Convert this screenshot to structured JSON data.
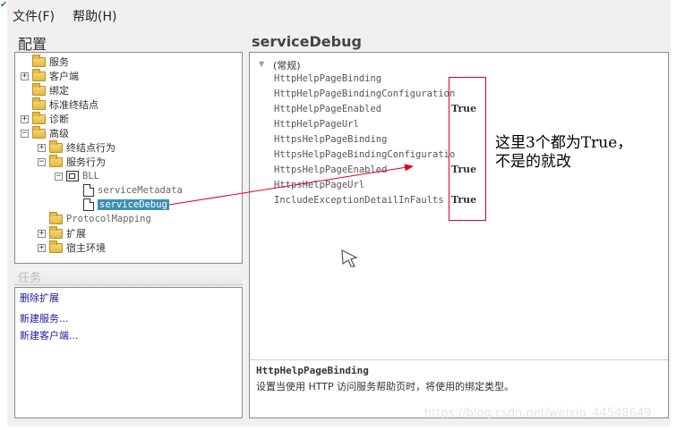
{
  "menubar": {
    "file": "文件(F)",
    "help": "帮助(H)"
  },
  "config_panel": {
    "title": "配置",
    "tree": [
      {
        "label": "服务",
        "icon": "folder-icon",
        "exp": ""
      },
      {
        "label": "客户端",
        "icon": "folder-icon",
        "exp": "+"
      },
      {
        "label": "绑定",
        "icon": "folder-icon",
        "exp": ""
      },
      {
        "label": "标准终结点",
        "icon": "folder-icon",
        "exp": ""
      },
      {
        "label": "诊断",
        "icon": "folder-icon",
        "exp": "+"
      },
      {
        "label": "高级",
        "icon": "folder-icon",
        "exp": "-"
      },
      {
        "label": "终结点行为",
        "icon": "folder-icon",
        "exp": "+"
      },
      {
        "label": "服务行为",
        "icon": "folder-icon",
        "exp": "-"
      },
      {
        "label": "BLL",
        "icon": "service-icon",
        "exp": "-"
      },
      {
        "label": "serviceMetadata",
        "icon": "document-icon",
        "exp": ""
      },
      {
        "label": "serviceDebug",
        "icon": "document-icon",
        "exp": ""
      },
      {
        "label": "ProtocolMapping",
        "icon": "folder-icon",
        "exp": ""
      },
      {
        "label": "扩展",
        "icon": "folder-icon",
        "exp": "+"
      },
      {
        "label": "宿主环境",
        "icon": "folder-icon",
        "exp": "+"
      }
    ]
  },
  "tasks_panel": {
    "title": "任务",
    "links": [
      "删除扩展",
      "新建服务...",
      "新建客户端..."
    ]
  },
  "detail_panel": {
    "title": "serviceDebug",
    "group": "(常规)",
    "properties": [
      {
        "name": "HttpHelpPageBinding",
        "value": ""
      },
      {
        "name": "HttpHelpPageBindingConfiguration",
        "value": ""
      },
      {
        "name": "HttpHelpPageEnabled",
        "value": "True"
      },
      {
        "name": "HttpHelpPageUrl",
        "value": ""
      },
      {
        "name": "HttpsHelpPageBinding",
        "value": ""
      },
      {
        "name": "HttpsHelpPageBindingConfiguratio",
        "value": ""
      },
      {
        "name": "HttpsHelpPageEnabled",
        "value": "True"
      },
      {
        "name": "HttpsHelpPageUrl",
        "value": ""
      },
      {
        "name": "IncludeExceptionDetailInFaults",
        "value": "True"
      }
    ],
    "description_title": "HttpHelpPageBinding",
    "description_text": "设置当使用 HTTP 访问服务帮助页时，将使用的绑定类型。"
  },
  "annotation": {
    "line1": "这里3个都为True，",
    "line2": "不是的就改"
  },
  "watermark": "https://blog.csdn.net/weixin_44548649",
  "colors": {
    "selection": "#3c8fb5",
    "annotation_red": "#e0001a",
    "link_blue": "#1a1a9a"
  }
}
